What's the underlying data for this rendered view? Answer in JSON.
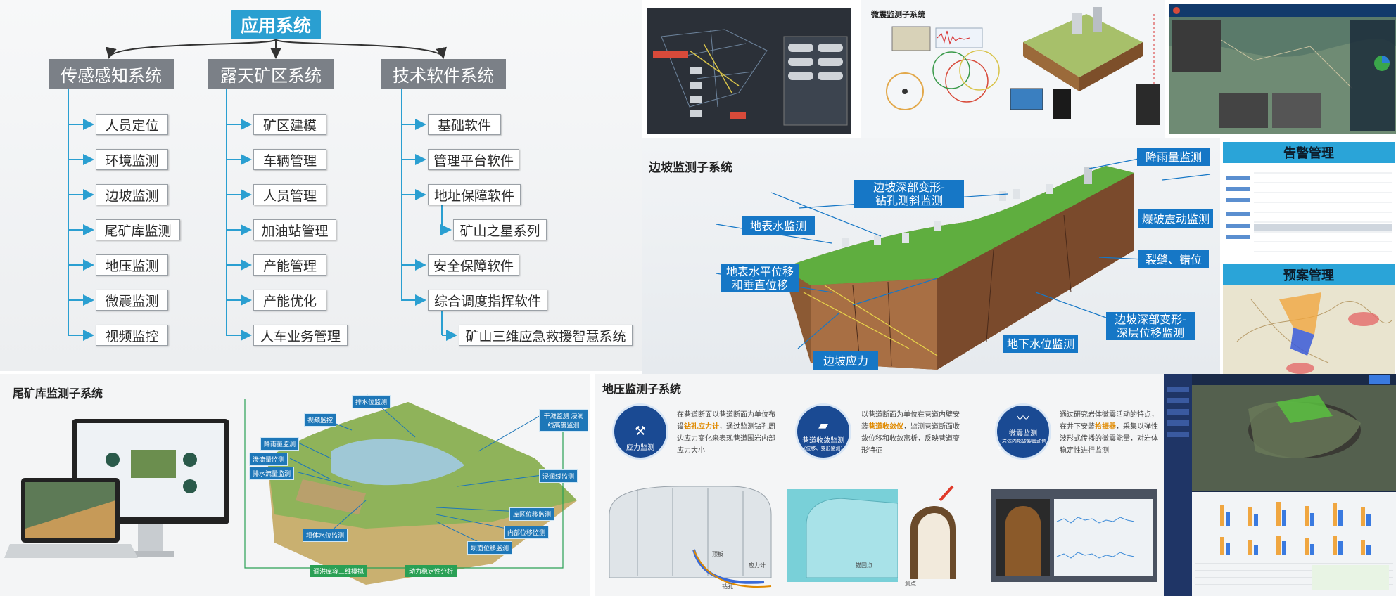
{
  "tree": {
    "root": "应用系统",
    "categories": [
      {
        "label": "传感感知系统",
        "items": [
          "人员定位",
          "环境监测",
          "边坡监测",
          "尾矿库监测",
          "地压监测",
          "微震监测",
          "视频监控"
        ]
      },
      {
        "label": "露天矿区系统",
        "items": [
          "矿区建模",
          "车辆管理",
          "人员管理",
          "加油站管理",
          "产能管理",
          "产能优化",
          "人车业务管理"
        ]
      },
      {
        "label": "技术软件系统",
        "items": [
          "基础软件",
          "管理平台软件",
          "地址保障软件",
          "矿山之星系列",
          "安全保障软件",
          "综合调度指挥软件",
          "矿山三维应急救援智慧系统"
        ]
      }
    ]
  },
  "microseism": {
    "title": "微震监测子系统"
  },
  "slope": {
    "title": "边坡监测子系统",
    "labels": {
      "rain": "降雨量监测",
      "deep_incl_1": "边坡深部变形-",
      "deep_incl_2": "钻孔测斜监测",
      "surface_water": "地表水监测",
      "blast": "爆破震动监测",
      "disp_1": "地表水平位移",
      "disp_2": "和垂直位移",
      "crack": "裂缝、错位",
      "deep_layer_1": "边坡深部变形-",
      "deep_layer_2": "深层位移监测",
      "groundwater": "地下水位监测",
      "stress": "边坡应力"
    }
  },
  "alarm": {
    "title": "告警管理"
  },
  "plan": {
    "title": "预案管理"
  },
  "tailings": {
    "title": "尾矿库监测子系统",
    "labels": [
      "排水位监测",
      "视频监控",
      "干滩监测 浸润线高度监测",
      "降雨量监测",
      "渗流量监测",
      "排水流量监测",
      "浸润线监测",
      "库区位移监测",
      "内部位移监测",
      "坝体水位监测",
      "坝面位移监测",
      "调洪库容三维模拟",
      "动力稳定性分析"
    ]
  },
  "pressure": {
    "title": "地压监测子系统",
    "cards": [
      {
        "icon_label": "应力监测",
        "text_before": "在巷道断面以巷道断面为单位布设",
        "highlight": "钻孔应力计",
        "text_after": "，通过监测钻孔周边应力变化来表现巷道围岩内部应力大小"
      },
      {
        "icon_label": "巷道收敛监测",
        "sub": "（位移、变形监测）",
        "text_before": "以巷道断面为单位在巷道内壁安装",
        "highlight": "巷道收敛仪",
        "text_after": "，监测巷道断面收敛位移和收敛离析，反映巷道变形特征"
      },
      {
        "icon_label": "微震监测",
        "sub": "（岩体内部破裂震动信号）",
        "text_before": "通过研究岩体微震活动的特点，在井下安装",
        "highlight": "拾振器",
        "text_after": "，采集以弹性波形式传播的微震能量，对岩体稳定性进行监测"
      }
    ],
    "tunnel_labels": [
      "顶板",
      "应力计",
      "钻孔",
      "测点",
      "锚固点"
    ]
  },
  "colors": {
    "accent": "#2a9fd1",
    "category": "#7b8087",
    "tag": "#1677c6",
    "highlight": "#e08a00"
  }
}
